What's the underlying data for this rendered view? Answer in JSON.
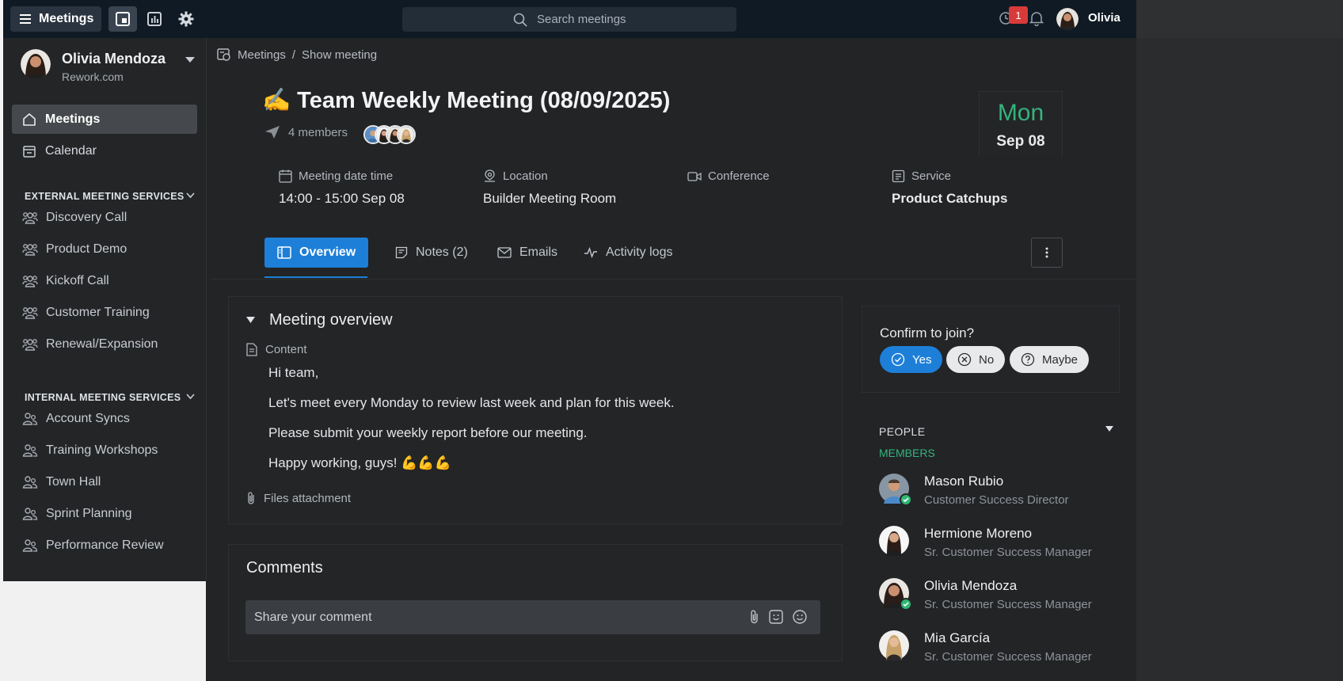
{
  "topbar": {
    "menu_label": "Meetings",
    "search_placeholder": "Search meetings",
    "notification_count": "1",
    "user_name": "Olivia"
  },
  "sidebar": {
    "profile": {
      "name": "Olivia Mendoza",
      "org": "Rework.com"
    },
    "nav": [
      {
        "label": "Meetings",
        "icon": "home-icon",
        "active": true
      },
      {
        "label": "Calendar",
        "icon": "calendar-icon",
        "active": false
      }
    ],
    "external_title": "EXTERNAL MEETING SERVICES",
    "external": [
      "Discovery Call",
      "Product Demo",
      "Kickoff Call",
      "Customer Training",
      "Renewal/Expansion"
    ],
    "internal_title": "INTERNAL MEETING SERVICES",
    "internal": [
      "Account Syncs",
      "Training Workshops",
      "Town Hall",
      "Sprint Planning",
      "Performance Review"
    ]
  },
  "breadcrumb": {
    "root": "Meetings",
    "sep": "/",
    "current": "Show meeting"
  },
  "meeting": {
    "title_emoji": "✍️",
    "title": "Team Weekly Meeting (08/09/2025)",
    "members_label": "4 members",
    "day_of_week": "Mon",
    "day_month": "Sep 08",
    "date_time_label": "Meeting date time",
    "date_time_value": "14:00 - 15:00 Sep 08",
    "location_label": "Location",
    "location_value": "Builder Meeting Room",
    "conference_label": "Conference",
    "service_label": "Service",
    "service_value": "Product Catchups"
  },
  "tabs": [
    {
      "label": "Overview",
      "icon": "overview-icon"
    },
    {
      "label": "Notes (2)",
      "icon": "notes-icon"
    },
    {
      "label": "Emails",
      "icon": "mail-icon"
    },
    {
      "label": "Activity logs",
      "icon": "activity-icon"
    }
  ],
  "overview": {
    "title": "Meeting overview",
    "content_label": "Content",
    "lines": [
      "Hi team,",
      "Let's meet every Monday to review last week and plan for this week.",
      "Please submit your weekly report before our meeting.",
      "Happy working, guys! 💪💪💪"
    ],
    "files_label": "Files attachment"
  },
  "comments": {
    "title": "Comments",
    "placeholder": "Share your comment"
  },
  "confirm": {
    "label": "Confirm to join?",
    "yes": "Yes",
    "no": "No",
    "maybe": "Maybe"
  },
  "people": {
    "title": "PEOPLE",
    "members_title": "MEMBERS",
    "list": [
      {
        "name": "Mason Rubio",
        "role": "Customer Success Director",
        "confirmed": true
      },
      {
        "name": "Hermione Moreno",
        "role": "Sr. Customer Success Manager",
        "confirmed": false
      },
      {
        "name": "Olivia Mendoza",
        "role": "Sr. Customer Success Manager",
        "confirmed": true
      },
      {
        "name": "Mia García",
        "role": "Sr. Customer Success Manager",
        "confirmed": false
      }
    ]
  },
  "colors": {
    "accent": "#1d7fd8",
    "success": "#36b37e",
    "badge": "#d83a3a"
  }
}
